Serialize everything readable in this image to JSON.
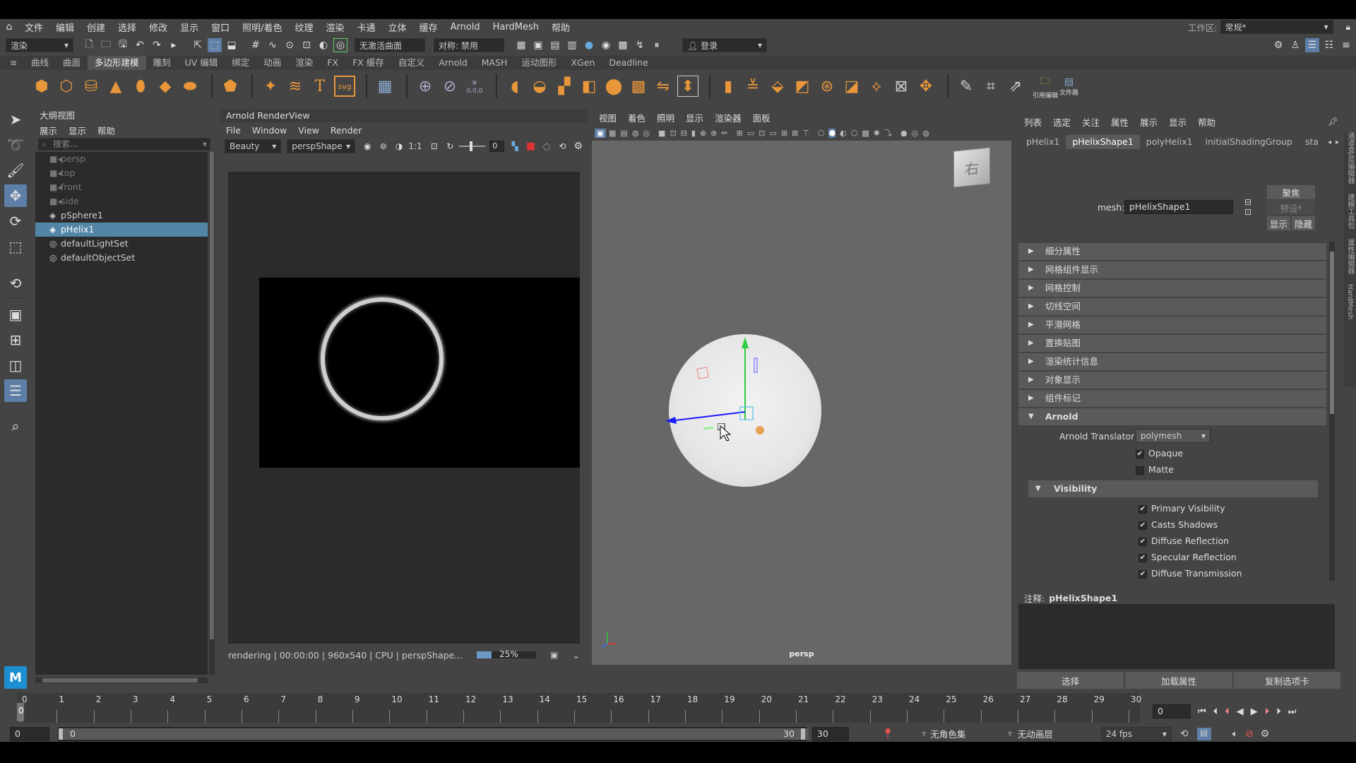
{
  "menubar": {
    "items": [
      "文件",
      "编辑",
      "创建",
      "选择",
      "修改",
      "显示",
      "窗口",
      "照明/着色",
      "纹理",
      "渲染",
      "卡通",
      "立体",
      "缓存",
      "Arnold",
      "HardMesh",
      "帮助"
    ],
    "workspace_label": "工作区:",
    "workspace_value": "常规*"
  },
  "statusline": {
    "menuset": "渲染",
    "live_surface": "无激活曲面",
    "symmetry": "对称: 禁用",
    "login": "登录"
  },
  "shelf": {
    "tabs": [
      "曲线",
      "曲面",
      "多边形建模",
      "雕刻",
      "UV 编辑",
      "绑定",
      "动画",
      "渲染",
      "FX",
      "FX 缓存",
      "自定义",
      "Arnold",
      "MASH",
      "运动图形",
      "XGen",
      "Deadline"
    ],
    "active_tab": "多边形建模",
    "coord_label": "0,0,0",
    "ref_editor_label": "引用编辑",
    "file_label": "文件路"
  },
  "outliner": {
    "title": "大纲视图",
    "menu": [
      "展示",
      "显示",
      "帮助"
    ],
    "search_placeholder": "搜索...",
    "items": [
      {
        "label": "persp",
        "icon": "camera-icon",
        "dim": true,
        "selected": false
      },
      {
        "label": "top",
        "icon": "camera-icon",
        "dim": true,
        "selected": false
      },
      {
        "label": "front",
        "icon": "camera-icon",
        "dim": true,
        "selected": false
      },
      {
        "label": "side",
        "icon": "camera-icon",
        "dim": true,
        "selected": false
      },
      {
        "label": "pSphere1",
        "icon": "mesh-icon",
        "dim": false,
        "selected": false
      },
      {
        "label": "pHelix1",
        "icon": "mesh-icon",
        "dim": false,
        "selected": true
      },
      {
        "label": "defaultLightSet",
        "icon": "set-icon",
        "dim": false,
        "selected": false
      },
      {
        "label": "defaultObjectSet",
        "icon": "set-icon",
        "dim": false,
        "selected": false
      }
    ]
  },
  "renderview": {
    "title": "Arnold RenderView",
    "menu": [
      "File",
      "Window",
      "View",
      "Render"
    ],
    "aov": "Beauty",
    "camera": "perspShape",
    "ratio": "1:1",
    "exposure": "0",
    "status": "rendering | 00:00:00 | 960x540 | CPU | perspShape...",
    "progress_percent": 25,
    "progress_label": "25%"
  },
  "viewport": {
    "menu": [
      "视图",
      "着色",
      "照明",
      "显示",
      "渲染器",
      "面板"
    ],
    "camera_label": "persp",
    "viewcube_label": "右"
  },
  "attribute_editor": {
    "menu": [
      "列表",
      "选定",
      "关注",
      "属性",
      "展示",
      "显示",
      "帮助"
    ],
    "tabs": [
      "pHelix1",
      "pHelixShape1",
      "polyHelix1",
      "initialShadingGroup",
      "sta"
    ],
    "active_tab": "pHelixShape1",
    "mesh_label": "mesh:",
    "mesh_value": "pHelixShape1",
    "focus_button": "聚焦",
    "preset_button": "预设*",
    "show_button": "显示",
    "hide_button": "隐藏",
    "sections": [
      "细分属性",
      "网格组件显示",
      "网格控制",
      "切线空间",
      "平滑网格",
      "置换贴图",
      "渲染统计信息",
      "对象显示",
      "组件标记"
    ],
    "arnold_section": "Arnold",
    "translator_label": "Arnold Translator",
    "translator_value": "polymesh",
    "opaque_label": "Opaque",
    "opaque_checked": true,
    "matte_label": "Matte",
    "matte_checked": false,
    "visibility_section": "Visibility",
    "visibility": [
      {
        "label": "Primary Visibility",
        "checked": true
      },
      {
        "label": "Casts Shadows",
        "checked": true
      },
      {
        "label": "Diffuse Reflection",
        "checked": true
      },
      {
        "label": "Specular Reflection",
        "checked": true
      },
      {
        "label": "Diffuse Transmission",
        "checked": true
      }
    ],
    "notes_label": "注释:",
    "notes_value": "pHelixShape1",
    "bottom_buttons": [
      "选择",
      "加载属性",
      "复制选项卡"
    ]
  },
  "timeline": {
    "ticks": [
      "0",
      "1",
      "2",
      "3",
      "4",
      "5",
      "6",
      "7",
      "8",
      "9",
      "10",
      "11",
      "12",
      "13",
      "14",
      "15",
      "16",
      "17",
      "18",
      "19",
      "20",
      "21",
      "22",
      "23",
      "24",
      "25",
      "26",
      "27",
      "28",
      "29",
      "30"
    ],
    "current_frame": "0",
    "current_frame_field": "0",
    "range_start": "0",
    "range_inner_start": "0",
    "range_inner_end": "30",
    "range_end": "30",
    "character_set": "无角色集",
    "anim_layer": "无动画层",
    "fps": "24 fps"
  },
  "side_tabs": [
    "通道盒/层编辑器",
    "建模工具包",
    "属性编辑器",
    "HardMesh"
  ],
  "colors": {
    "accent": "#5285a6",
    "panel": "#444444",
    "field": "#2b2b2b",
    "viewport_bg": "#676767"
  }
}
